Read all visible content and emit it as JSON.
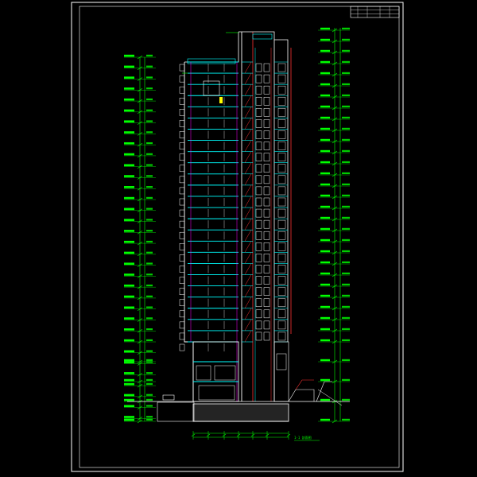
{
  "drawing": {
    "title": "",
    "section_label": "1-1 剖面图"
  },
  "colors": {
    "background": "#000000",
    "frame": "#ffffff",
    "dimension": "#00ff00",
    "wall": "#ffffff",
    "slab": "#00ffff",
    "stair": "#ff3333",
    "accent": "#ffff00",
    "column_magenta": "#ff00ff"
  },
  "building": {
    "typical_floors": 25,
    "podium_floors": 2,
    "basement_floors": 1
  },
  "icons": [
    "level-marker-icon",
    "dimension-tick-icon",
    "north-arrow-icon"
  ]
}
